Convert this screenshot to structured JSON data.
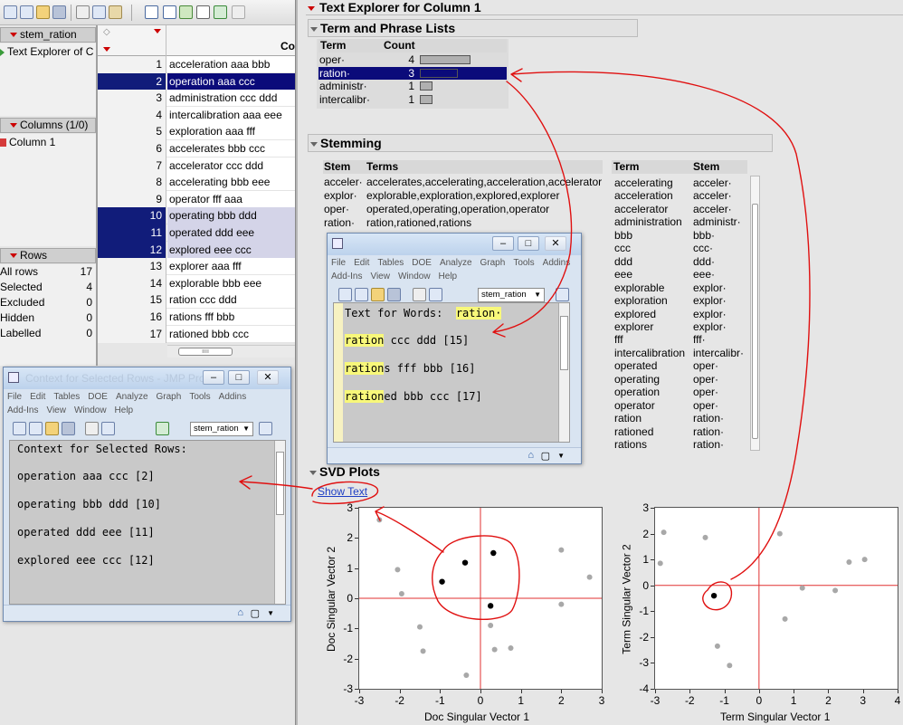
{
  "left_panel": {
    "table_name": "stem_ration",
    "table_script": "Text Explorer of C",
    "columns_header": "Columns (1/0)",
    "column_item": "Column 1",
    "rows_header": "Rows",
    "row_stats": [
      {
        "label": "All rows",
        "value": "17"
      },
      {
        "label": "Selected",
        "value": "4"
      },
      {
        "label": "Excluded",
        "value": "0"
      },
      {
        "label": "Hidden",
        "value": "0"
      },
      {
        "label": "Labelled",
        "value": "0"
      }
    ]
  },
  "data_grid": {
    "column_header": "Col",
    "rows": [
      {
        "num": "1",
        "text": "acceleration aaa bbb",
        "selected": false
      },
      {
        "num": "2",
        "text": "operation aaa ccc",
        "selected": true
      },
      {
        "num": "3",
        "text": "administration ccc ddd",
        "selected": false
      },
      {
        "num": "4",
        "text": "intercalibration aaa eee",
        "selected": false
      },
      {
        "num": "5",
        "text": "exploration aaa fff",
        "selected": false
      },
      {
        "num": "6",
        "text": "accelerates bbb ccc",
        "selected": false
      },
      {
        "num": "7",
        "text": "accelerator ccc ddd",
        "selected": false
      },
      {
        "num": "8",
        "text": "accelerating bbb eee",
        "selected": false
      },
      {
        "num": "9",
        "text": "operator fff aaa",
        "selected": false
      },
      {
        "num": "10",
        "text": "operating bbb ddd",
        "selected": true
      },
      {
        "num": "11",
        "text": "operated ddd eee",
        "selected": true
      },
      {
        "num": "12",
        "text": "explored eee ccc",
        "selected": true
      },
      {
        "num": "13",
        "text": "explorer aaa fff",
        "selected": false
      },
      {
        "num": "14",
        "text": "explorable bbb eee",
        "selected": false
      },
      {
        "num": "15",
        "text": "ration ccc ddd",
        "selected": false
      },
      {
        "num": "16",
        "text": "rations fff bbb",
        "selected": false
      },
      {
        "num": "17",
        "text": "rationed bbb ccc",
        "selected": false
      }
    ]
  },
  "report": {
    "title": "Text Explorer for Column 1",
    "term_section": "Term and Phrase Lists",
    "term_headers": {
      "term": "Term",
      "count": "Count"
    },
    "terms": [
      {
        "term": "oper·",
        "count": "4",
        "fraction": 1.0,
        "selected": false
      },
      {
        "term": "ration·",
        "count": "3",
        "fraction": 0.75,
        "selected": true
      },
      {
        "term": "administr·",
        "count": "1",
        "fraction": 0.25,
        "selected": false
      },
      {
        "term": "intercalibr·",
        "count": "1",
        "fraction": 0.25,
        "selected": false
      }
    ],
    "stemming_section": "Stemming",
    "stem_headers": {
      "stem": "Stem",
      "terms": "Terms"
    },
    "stems": [
      {
        "stem": "acceler·",
        "terms": "accelerates,accelerating,acceleration,accelerator"
      },
      {
        "stem": "explor·",
        "terms": "explorable,exploration,explored,explorer"
      },
      {
        "stem": "oper·",
        "terms": "operated,operating,operation,operator"
      },
      {
        "stem": "ration·",
        "terms": "ration,rationed,rations"
      }
    ],
    "term_stem_headers": {
      "term": "Term",
      "stem": "Stem"
    },
    "term_stems": [
      {
        "term": "accelerating",
        "stem": "acceler·"
      },
      {
        "term": "acceleration",
        "stem": "acceler·"
      },
      {
        "term": "accelerator",
        "stem": "acceler·"
      },
      {
        "term": "administration",
        "stem": "administr·"
      },
      {
        "term": "bbb",
        "stem": "bbb·"
      },
      {
        "term": "ccc",
        "stem": "ccc·"
      },
      {
        "term": "ddd",
        "stem": "ddd·"
      },
      {
        "term": "eee",
        "stem": "eee·"
      },
      {
        "term": "explorable",
        "stem": "explor·"
      },
      {
        "term": "exploration",
        "stem": "explor·"
      },
      {
        "term": "explored",
        "stem": "explor·"
      },
      {
        "term": "explorer",
        "stem": "explor·"
      },
      {
        "term": "fff",
        "stem": "fff·"
      },
      {
        "term": "intercalibration",
        "stem": "intercalibr·"
      },
      {
        "term": "operated",
        "stem": "oper·"
      },
      {
        "term": "operating",
        "stem": "oper·"
      },
      {
        "term": "operation",
        "stem": "oper·"
      },
      {
        "term": "operator",
        "stem": "oper·"
      },
      {
        "term": "ration",
        "stem": "ration·"
      },
      {
        "term": "rationed",
        "stem": "ration·"
      },
      {
        "term": "rations",
        "stem": "ration·"
      }
    ],
    "svd_section": "SVD Plots",
    "show_text_link": "Show Text"
  },
  "words_window": {
    "menu": [
      "File",
      "Edit",
      "Tables",
      "DOE",
      "Analyze",
      "Graph",
      "Tools",
      "Addins",
      "Add-Ins",
      "View",
      "Window",
      "Help"
    ],
    "combo_value": "stem_ration",
    "header_prefix": "Text for Words:  ",
    "header_term": "ration·",
    "lines": [
      {
        "hl": "ration",
        "rest": " ccc ddd [15]"
      },
      {
        "hl": "ration",
        "rest": "s fff bbb [16]"
      },
      {
        "hl": "ration",
        "rest": "ed bbb ccc [17]"
      }
    ]
  },
  "context_window": {
    "title": "Context for Selected Rows - JMP Pro",
    "menu": [
      "File",
      "Edit",
      "Tables",
      "DOE",
      "Analyze",
      "Graph",
      "Tools",
      "Addins",
      "Add-Ins",
      "View",
      "Window",
      "Help"
    ],
    "combo_value": "stem_ration",
    "lines": [
      "Context for Selected Rows:",
      "operation aaa ccc [2]",
      "operating bbb ddd [10]",
      "operated ddd eee [11]",
      "explored eee ccc [12]"
    ]
  },
  "chart_data": [
    {
      "type": "scatter",
      "title": "",
      "xlabel": "Doc Singular Vector 1",
      "ylabel": "Doc Singular Vector 2",
      "xlim": [
        -3,
        3
      ],
      "ylim": [
        -3,
        3
      ],
      "xticks": [
        "-3",
        "-2",
        "-1",
        "0",
        "1",
        "2",
        "3"
      ],
      "yticks": [
        "-3",
        "-2",
        "-1",
        "0",
        "1",
        "2",
        "3"
      ],
      "reference_lines": {
        "x": 0,
        "y": 0,
        "color": "#e03030"
      },
      "points": [
        {
          "x": -2.5,
          "y": 2.6,
          "highlighted": false
        },
        {
          "x": -2.05,
          "y": 0.95,
          "highlighted": false
        },
        {
          "x": -1.95,
          "y": 0.15,
          "highlighted": false
        },
        {
          "x": -1.5,
          "y": -0.95,
          "highlighted": false
        },
        {
          "x": -1.42,
          "y": -1.75,
          "highlighted": false
        },
        {
          "x": -0.95,
          "y": 0.55,
          "highlighted": true
        },
        {
          "x": -0.38,
          "y": 1.18,
          "highlighted": true
        },
        {
          "x": -0.35,
          "y": -2.55,
          "highlighted": false
        },
        {
          "x": 0.25,
          "y": -0.9,
          "highlighted": false
        },
        {
          "x": 0.25,
          "y": -0.25,
          "highlighted": true
        },
        {
          "x": 0.32,
          "y": 1.5,
          "highlighted": true
        },
        {
          "x": 0.35,
          "y": -1.7,
          "highlighted": false
        },
        {
          "x": 0.75,
          "y": -1.65,
          "highlighted": false
        },
        {
          "x": 2.0,
          "y": 1.6,
          "highlighted": false
        },
        {
          "x": 2.0,
          "y": -0.2,
          "highlighted": false
        },
        {
          "x": 2.7,
          "y": 0.7,
          "highlighted": false
        }
      ]
    },
    {
      "type": "scatter",
      "title": "",
      "xlabel": "Term Singular Vector 1",
      "ylabel": "Term Singular Vector 2",
      "xlim": [
        -3,
        4
      ],
      "ylim": [
        -4,
        3
      ],
      "xticks": [
        "-3",
        "-2",
        "-1",
        "0",
        "1",
        "2",
        "3",
        "4"
      ],
      "yticks": [
        "-4",
        "-3",
        "-2",
        "-1",
        "0",
        "1",
        "2",
        "3"
      ],
      "reference_lines": {
        "x": 0,
        "y": 0,
        "color": "#e03030"
      },
      "points": [
        {
          "x": -2.75,
          "y": 2.05,
          "highlighted": false
        },
        {
          "x": -2.85,
          "y": 0.85,
          "highlighted": false
        },
        {
          "x": -1.55,
          "y": 1.85,
          "highlighted": false
        },
        {
          "x": -1.3,
          "y": -0.4,
          "highlighted": true
        },
        {
          "x": -1.2,
          "y": -2.35,
          "highlighted": false
        },
        {
          "x": -0.85,
          "y": -3.1,
          "highlighted": false
        },
        {
          "x": 0.6,
          "y": 2.0,
          "highlighted": false
        },
        {
          "x": 0.75,
          "y": -1.3,
          "highlighted": false
        },
        {
          "x": 1.25,
          "y": -0.1,
          "highlighted": false
        },
        {
          "x": 2.2,
          "y": -0.2,
          "highlighted": false
        },
        {
          "x": 2.6,
          "y": 0.9,
          "highlighted": false
        },
        {
          "x": 3.05,
          "y": 1.0,
          "highlighted": false
        }
      ]
    }
  ]
}
